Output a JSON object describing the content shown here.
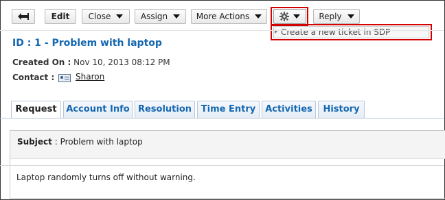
{
  "toolbar": {
    "back_icon": "back-arrow-icon",
    "edit_label": "Edit",
    "close_label": "Close",
    "assign_label": "Assign",
    "more_actions_label": "More Actions",
    "settings_icon": "gear-icon",
    "reply_label": "Reply"
  },
  "dropdown": {
    "item_label": "Create a new ticket in SDP"
  },
  "ticket": {
    "title": "ID : 1 - Problem with laptop",
    "created_on_label": "Created On :",
    "created_on_value": "Nov 10, 2013 08:12 PM",
    "contact_label": "Contact :",
    "contact_name": "Sharon"
  },
  "tabs": [
    {
      "label": "Request"
    },
    {
      "label": "Account Info"
    },
    {
      "label": "Resolution"
    },
    {
      "label": "Time Entry"
    },
    {
      "label": "Activities"
    },
    {
      "label": "History"
    }
  ],
  "request": {
    "subject_label": "Subject",
    "subject_value": ": Problem with laptop",
    "description": "Laptop randomly turns off without warning."
  },
  "colors": {
    "accent": "#1467b1",
    "highlight": "#d40000"
  }
}
